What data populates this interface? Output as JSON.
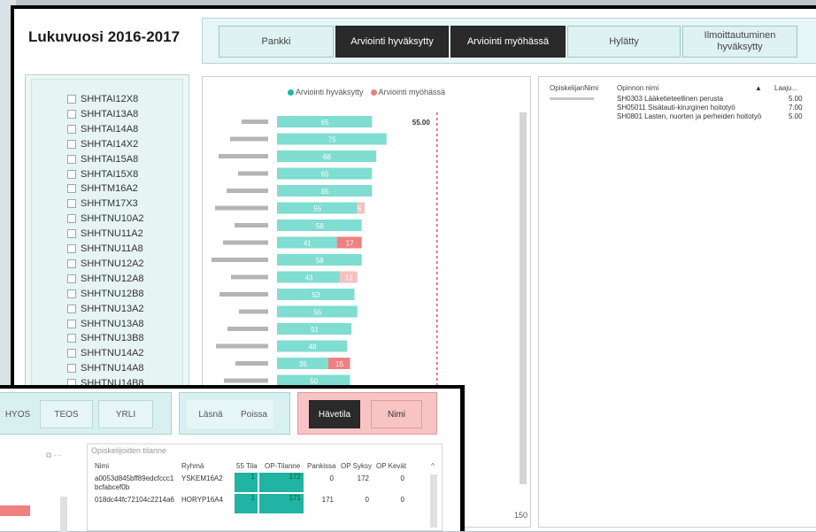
{
  "header": {
    "title": "Lukuvuosi 2016-2017",
    "tabs": [
      {
        "label": "Pankki"
      },
      {
        "label": "Arviointi hyväksytty"
      },
      {
        "label": "Arviointi myöhässä"
      },
      {
        "label": "Hylätty"
      },
      {
        "label": "Ilmoittautuminen hyväksytty"
      }
    ]
  },
  "slicer": {
    "items": [
      "SHHTAI12X8",
      "SHHTAI13A8",
      "SHHTAI14A8",
      "SHHTAI14X2",
      "SHHTAI15A8",
      "SHHTAI15X8",
      "SHHTM16A2",
      "SHHTM17X3",
      "SHHTNU10A2",
      "SHHTNU11A2",
      "SHHTNU11A8",
      "SHHTNU12A2",
      "SHHTNU12A8",
      "SHHTNU12B8",
      "SHHTNU13A2",
      "SHHTNU13A8",
      "SHHTNU13B8",
      "SHHTNU14A2",
      "SHHTNU14A8",
      "SHHTNU14B8"
    ]
  },
  "chart_data": {
    "type": "bar",
    "axis_end_label": "150",
    "reference_label": "55.00",
    "reference_value": 55,
    "xlim": [
      0,
      150
    ],
    "series": [
      {
        "name": "Arviointi hyväksytty",
        "color": "#7fddd1",
        "values": [
          65,
          75,
          68,
          65,
          65,
          55,
          58,
          41,
          58,
          43,
          53,
          55,
          51,
          48,
          35,
          50,
          50,
          50,
          50
        ]
      },
      {
        "name": "Arviointi myöhässä",
        "color": "#f08080",
        "values": [
          0,
          0,
          0,
          0,
          0,
          5,
          0,
          17,
          0,
          12,
          0,
          0,
          0,
          0,
          15,
          0,
          0,
          0,
          0
        ]
      }
    ]
  },
  "courses": {
    "columns": [
      "OpiskelijanNimi",
      "Opinnon nimi",
      "Laaju..."
    ],
    "sort_glyph": "▲",
    "rows": [
      {
        "course": "SH0303 Lääketieteellinen perusta",
        "scope": "5.00"
      },
      {
        "course": "SH05011 Sisätauti-kirurginen hoitotyö",
        "scope": "7.00"
      },
      {
        "course": "SH0801 Lasten, nuorten ja perheiden hoitotyö",
        "scope": "5.00"
      }
    ]
  },
  "overlay": {
    "filters1": [
      "HYOS",
      "TEOS",
      "YRLI"
    ],
    "filters2": [
      "Läsnä",
      "Poissa"
    ],
    "filters3": [
      "Hävetila",
      "Nimi"
    ],
    "visual_icons": "⧉ ···"
  },
  "status_table": {
    "title": "Opiskelijoiden tilanne",
    "scroll_glyph": "^",
    "columns": [
      "Nimi",
      "Ryhmä",
      "55 Tila",
      "OP-Tilanne",
      "Pankissa",
      "OP Syksy",
      "OP Kevät"
    ],
    "rows": [
      {
        "nimi": "a0053d845bff89edcfccc1",
        "nimi2": "bcfabcef0b",
        "ryhma": "YSKEM16A2",
        "tila": "1",
        "op": "172",
        "pankissa": "0",
        "syksy": "172",
        "kevat": "0"
      },
      {
        "nimi": "018dc44fc72104c2214a6",
        "nimi2": "",
        "ryhma": "HORYP16A4",
        "tila": "1",
        "op": "171",
        "pankissa": "171",
        "syksy": "0",
        "kevat": "0"
      }
    ]
  }
}
